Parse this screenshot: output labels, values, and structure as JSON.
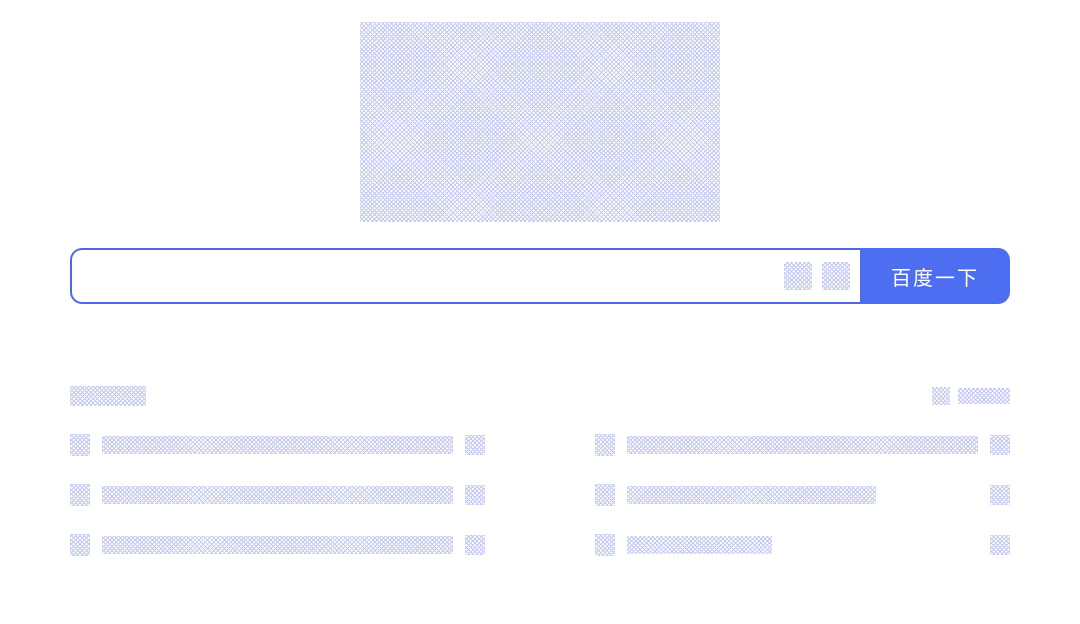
{
  "search": {
    "button_label": "百度一下",
    "placeholder": ""
  },
  "hot": {
    "title": "",
    "refresh_label": "",
    "items": [
      {
        "rank": "",
        "text": "",
        "tag": ""
      },
      {
        "rank": "",
        "text": "",
        "tag": ""
      },
      {
        "rank": "",
        "text": "",
        "tag": ""
      },
      {
        "rank": "",
        "text": "",
        "tag": ""
      },
      {
        "rank": "",
        "text": "",
        "tag": ""
      },
      {
        "rank": "",
        "text": "",
        "tag": ""
      }
    ]
  }
}
